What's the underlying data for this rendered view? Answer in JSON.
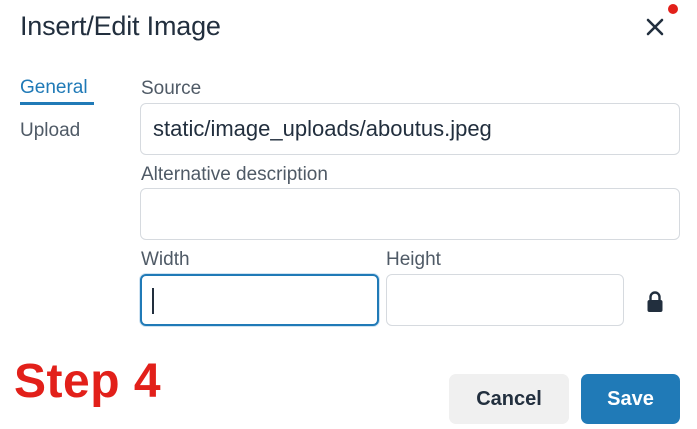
{
  "dialog": {
    "title": "Insert/Edit Image",
    "close_icon": "close-icon"
  },
  "tabs": [
    {
      "label": "General",
      "active": true
    },
    {
      "label": "Upload",
      "active": false
    }
  ],
  "fields": {
    "source": {
      "label": "Source",
      "value": "static/image_uploads/aboutus.jpeg"
    },
    "alt": {
      "label": "Alternative description",
      "value": ""
    },
    "width": {
      "label": "Width",
      "value": ""
    },
    "height": {
      "label": "Height",
      "value": ""
    },
    "lock_icon": "lock-icon"
  },
  "annotation": {
    "step": "Step 4"
  },
  "buttons": {
    "cancel": "Cancel",
    "save": "Save"
  },
  "colors": {
    "accent": "#207ab7",
    "annotation": "#e2201a",
    "text": "#222f3e"
  }
}
